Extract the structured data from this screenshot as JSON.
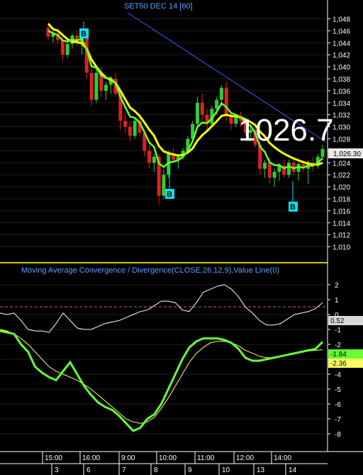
{
  "price_panel": {
    "title": "SET50 DEC 14  [60]",
    "last_price_big": "1026.7",
    "last_price_tag": "1,026.30",
    "y_ticks": [
      "1,048",
      "1,046",
      "1,044",
      "1,042",
      "1,040",
      "1,038",
      "1,036",
      "1,034",
      "1,032",
      "1,030",
      "1,028",
      "1,026",
      "1,024",
      "1,022",
      "1,020",
      "1,018",
      "1,016",
      "1,014",
      "1,012",
      "1,010"
    ],
    "buy_marker_label": "B"
  },
  "macd_panel": {
    "title": "Moving Average Convergence / Divergence(CLOSE,26,12,9),Value Line(0)",
    "y_ticks": [
      "2",
      "1",
      "0",
      "-1",
      "-2",
      "-3",
      "-4",
      "-5",
      "-6",
      "-7",
      "-8"
    ],
    "value_tag": "0.52",
    "macd_tag": "-1.84",
    "signal_tag": "-2.36"
  },
  "x_axis": {
    "time_labels": [
      "15:00",
      "16:00",
      "9:00",
      "10:00",
      "11:00",
      "12:00",
      "14:00"
    ],
    "date_labels": [
      "3",
      "6",
      "7",
      "8",
      "9",
      "10",
      "13",
      "14"
    ]
  },
  "colors": {
    "background": "#000000",
    "up_candle": "#33cc33",
    "down_candle": "#e02020",
    "ma_fast": "#ffff00",
    "ma_slow": "#66ff33",
    "trendline": "#4455ff",
    "buy_marker": "#00e5ee",
    "panel_divider": "#cccc00",
    "zero_line": "#cc6666"
  },
  "chart_data": [
    {
      "type": "candlestick",
      "title": "SET50 DEC 14  [60]",
      "ylim": [
        1009,
        1049
      ],
      "y_ticks": [
        1048,
        1046,
        1044,
        1042,
        1040,
        1038,
        1036,
        1034,
        1032,
        1030,
        1028,
        1026,
        1024,
        1022,
        1020,
        1018,
        1016,
        1014,
        1012,
        1010
      ],
      "last": 1026.3,
      "ohlc": [
        [
          1046.5,
          1047.2,
          1044.5,
          1045.0
        ],
        [
          1045.0,
          1046.0,
          1044.0,
          1045.5
        ],
        [
          1045.5,
          1046.5,
          1043.8,
          1044.5
        ],
        [
          1044.5,
          1045.0,
          1041.0,
          1042.0
        ],
        [
          1042.0,
          1044.5,
          1041.5,
          1043.8
        ],
        [
          1043.8,
          1045.5,
          1043.0,
          1045.2
        ],
        [
          1045.2,
          1046.0,
          1043.5,
          1044.0
        ],
        [
          1044.0,
          1045.5,
          1042.0,
          1045.0
        ],
        [
          1045.0,
          1045.5,
          1038.0,
          1039.0
        ],
        [
          1039.0,
          1040.5,
          1033.5,
          1034.5
        ],
        [
          1034.5,
          1039.5,
          1034.0,
          1039.0
        ],
        [
          1039.0,
          1040.0,
          1035.0,
          1036.0
        ],
        [
          1036.0,
          1037.5,
          1034.5,
          1037.0
        ],
        [
          1037.0,
          1038.5,
          1035.5,
          1038.0
        ],
        [
          1038.0,
          1039.0,
          1035.0,
          1035.5
        ],
        [
          1035.5,
          1036.0,
          1029.5,
          1031.0
        ],
        [
          1031.0,
          1032.5,
          1029.0,
          1030.0
        ],
        [
          1030.0,
          1031.0,
          1027.5,
          1028.5
        ],
        [
          1028.5,
          1031.5,
          1028.0,
          1031.0
        ],
        [
          1031.0,
          1032.0,
          1028.5,
          1029.0
        ],
        [
          1029.0,
          1029.5,
          1025.0,
          1026.0
        ],
        [
          1026.0,
          1027.5,
          1023.0,
          1024.0
        ],
        [
          1024.0,
          1025.5,
          1022.5,
          1025.0
        ],
        [
          1025.0,
          1025.5,
          1017.0,
          1018.5
        ],
        [
          1018.5,
          1023.0,
          1018.0,
          1022.0
        ],
        [
          1022.0,
          1026.0,
          1021.5,
          1025.5
        ],
        [
          1025.5,
          1026.5,
          1024.0,
          1024.5
        ],
        [
          1024.5,
          1025.5,
          1023.0,
          1025.0
        ],
        [
          1025.0,
          1026.5,
          1024.5,
          1026.0
        ],
        [
          1026.0,
          1028.5,
          1025.5,
          1028.0
        ],
        [
          1028.0,
          1031.0,
          1027.5,
          1030.5
        ],
        [
          1030.5,
          1035.0,
          1030.0,
          1034.0
        ],
        [
          1034.0,
          1035.5,
          1031.0,
          1032.0
        ],
        [
          1032.0,
          1033.0,
          1029.5,
          1030.5
        ],
        [
          1030.5,
          1033.5,
          1030.0,
          1033.0
        ],
        [
          1033.0,
          1035.0,
          1032.0,
          1034.5
        ],
        [
          1034.5,
          1037.0,
          1033.5,
          1036.5
        ],
        [
          1036.5,
          1037.5,
          1031.0,
          1032.0
        ],
        [
          1032.0,
          1032.5,
          1029.5,
          1030.5
        ],
        [
          1030.5,
          1032.0,
          1030.0,
          1031.5
        ],
        [
          1031.5,
          1032.5,
          1030.0,
          1031.0
        ],
        [
          1031.0,
          1031.5,
          1028.5,
          1029.0
        ],
        [
          1029.0,
          1030.0,
          1027.5,
          1029.5
        ],
        [
          1029.5,
          1030.5,
          1026.5,
          1027.0
        ],
        [
          1027.0,
          1027.5,
          1022.0,
          1023.0
        ],
        [
          1023.0,
          1024.5,
          1021.5,
          1024.0
        ],
        [
          1024.0,
          1025.0,
          1020.5,
          1021.5
        ],
        [
          1021.5,
          1023.0,
          1020.0,
          1022.5
        ],
        [
          1022.5,
          1024.0,
          1021.0,
          1023.5
        ],
        [
          1023.5,
          1024.5,
          1021.5,
          1022.0
        ],
        [
          1022.0,
          1024.5,
          1021.5,
          1024.0
        ],
        [
          1024.0,
          1025.0,
          1022.0,
          1022.5
        ],
        [
          1022.5,
          1024.0,
          1021.0,
          1023.8
        ],
        [
          1023.8,
          1024.5,
          1022.5,
          1023.0
        ],
        [
          1023.0,
          1024.5,
          1020.5,
          1024.0
        ],
        [
          1024.0,
          1025.0,
          1022.5,
          1023.5
        ],
        [
          1023.5,
          1025.5,
          1023.0,
          1025.0
        ],
        [
          1025.0,
          1027.0,
          1024.5,
          1026.3
        ]
      ],
      "series": [
        {
          "values": [
            1047.2,
            1046.3,
            1046.0,
            1045.3,
            1044.6,
            1044.2,
            1044.1,
            1043.9,
            1043.0,
            1041.2,
            1040.0,
            1039.0,
            1038.2,
            1037.8,
            1037.3,
            1036.0,
            1034.6,
            1033.2,
            1032.6,
            1031.8,
            1030.7,
            1029.5,
            1028.5,
            1026.8,
            1025.9,
            1025.6,
            1025.4,
            1025.2,
            1025.3,
            1025.7,
            1026.4,
            1027.7,
            1028.6,
            1029.3,
            1030.1,
            1030.9,
            1031.8,
            1032.0,
            1031.8,
            1031.7,
            1031.6,
            1031.2,
            1030.8,
            1030.3,
            1029.2,
            1028.4,
            1027.3,
            1026.6,
            1026.0,
            1025.5,
            1025.1,
            1024.7,
            1024.4,
            1024.1,
            1023.9,
            1023.7,
            1023.7,
            1024.0
          ]
        },
        {
          "values": [
            1046.0,
            1045.6,
            1045.3,
            1044.4,
            1044.2,
            1044.5,
            1044.4,
            1044.6,
            1042.9,
            1040.1,
            1039.8,
            1038.6,
            1038.1,
            1038.1,
            1037.2,
            1035.0,
            1033.3,
            1031.7,
            1031.5,
            1030.7,
            1029.1,
            1027.4,
            1026.6,
            1023.9,
            1023.3,
            1024.0,
            1024.2,
            1024.4,
            1025.0,
            1026.0,
            1027.6,
            1030.0,
            1030.7,
            1030.6,
            1031.4,
            1032.5,
            1033.9,
            1033.3,
            1032.3,
            1032.0,
            1031.6,
            1030.6,
            1030.2,
            1029.0,
            1026.7,
            1025.8,
            1024.1,
            1023.6,
            1023.6,
            1023.1,
            1023.4,
            1023.1,
            1023.3,
            1023.2,
            1023.5,
            1023.5,
            1024.0,
            1024.8
          ]
        }
      ]
    },
    {
      "type": "line",
      "title": "Moving Average Convergence / Divergence(CLOSE,26,12,9),Value Line(0)",
      "ylim": [
        -9,
        3
      ],
      "y_ticks": [
        2,
        1,
        0,
        -1,
        -2,
        -3,
        -4,
        -5,
        -6,
        -7,
        -8
      ],
      "series": [
        {
          "values": [
            0.1,
            0.0,
            0.1,
            -0.4,
            -1.0,
            -1.1,
            -1.1,
            -1.2,
            -0.6,
            0.1,
            -0.4,
            -0.9,
            -1.0,
            -1.0,
            -0.8,
            -0.6,
            -0.5,
            -0.4,
            -0.2,
            0.0,
            0.2,
            0.3,
            0.6,
            0.9,
            0.9,
            0.8,
            0.3,
            0.2,
            0.8,
            1.5,
            1.7,
            1.9,
            2.0,
            1.7,
            1.2,
            0.5,
            0.1,
            -0.4,
            -0.7,
            -0.7,
            -0.6,
            -0.3,
            0.0,
            0.1,
            0.2,
            0.4,
            0.8
          ]
        },
        {
          "values": [
            -1.1,
            -1.2,
            -1.3,
            -2.0,
            -2.5,
            -3.5,
            -3.9,
            -4.2,
            -4.4,
            -3.8,
            -3.2,
            -4.0,
            -4.8,
            -5.4,
            -5.9,
            -6.2,
            -6.4,
            -6.8,
            -7.3,
            -7.8,
            -7.6,
            -7.0,
            -6.7,
            -6.0,
            -5.0,
            -4.0,
            -3.0,
            -2.2,
            -1.8,
            -1.6,
            -1.6,
            -1.6,
            -1.7,
            -1.9,
            -2.3,
            -2.9,
            -3.1,
            -3.1,
            -3.0,
            -2.9,
            -2.8,
            -2.7,
            -2.6,
            -2.5,
            -2.4,
            -2.3,
            -1.84
          ]
        },
        {
          "values": [
            -1.0,
            -1.1,
            -1.3,
            -1.6,
            -2.0,
            -2.5,
            -3.0,
            -3.5,
            -3.8,
            -4.0,
            -4.2,
            -4.4,
            -4.7,
            -5.0,
            -5.4,
            -5.8,
            -6.2,
            -6.6,
            -7.0,
            -7.2,
            -7.3,
            -7.2,
            -6.9,
            -6.3,
            -5.6,
            -4.8,
            -4.0,
            -3.2,
            -2.6,
            -2.2,
            -1.9,
            -1.8,
            -1.8,
            -1.9,
            -2.1,
            -2.4,
            -2.6,
            -2.8,
            -2.9,
            -2.9,
            -2.8,
            -2.7,
            -2.6,
            -2.5,
            -2.45,
            -2.4,
            -2.36
          ]
        }
      ]
    }
  ]
}
